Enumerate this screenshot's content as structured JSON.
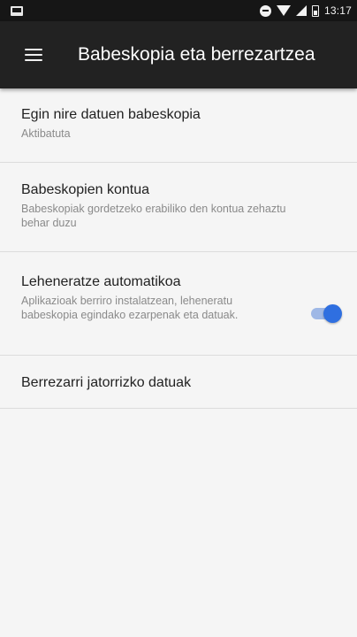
{
  "status_bar": {
    "time": "13:17",
    "icons": [
      "notification-icon",
      "do-not-disturb-icon",
      "wifi-icon",
      "signal-icon",
      "battery-icon"
    ]
  },
  "app_bar": {
    "title": "Babeskopia eta berrezartzea",
    "menu_icon": "hamburger-menu-icon"
  },
  "settings": {
    "backup": {
      "title": "Egin nire datuen babeskopia",
      "summary": "Aktibatuta"
    },
    "account": {
      "title": "Babeskopien kontua",
      "summary": "Babeskopiak gordetzeko erabiliko den kontua zehaztu behar duzu"
    },
    "auto_restore": {
      "title": "Leheneratze automatikoa",
      "summary": "Aplikazioak berriro instalatzean, leheneratu babeskopia egindako ezarpenak eta datuak.",
      "enabled": true
    },
    "factory_reset": {
      "title": "Berrezarri jatorrizko datuak"
    }
  },
  "colors": {
    "app_bar": "#222222",
    "status_bar": "#161616",
    "background": "#f5f5f5",
    "accent": "#2f6fe0",
    "switch_track": "#9fb8e6"
  }
}
